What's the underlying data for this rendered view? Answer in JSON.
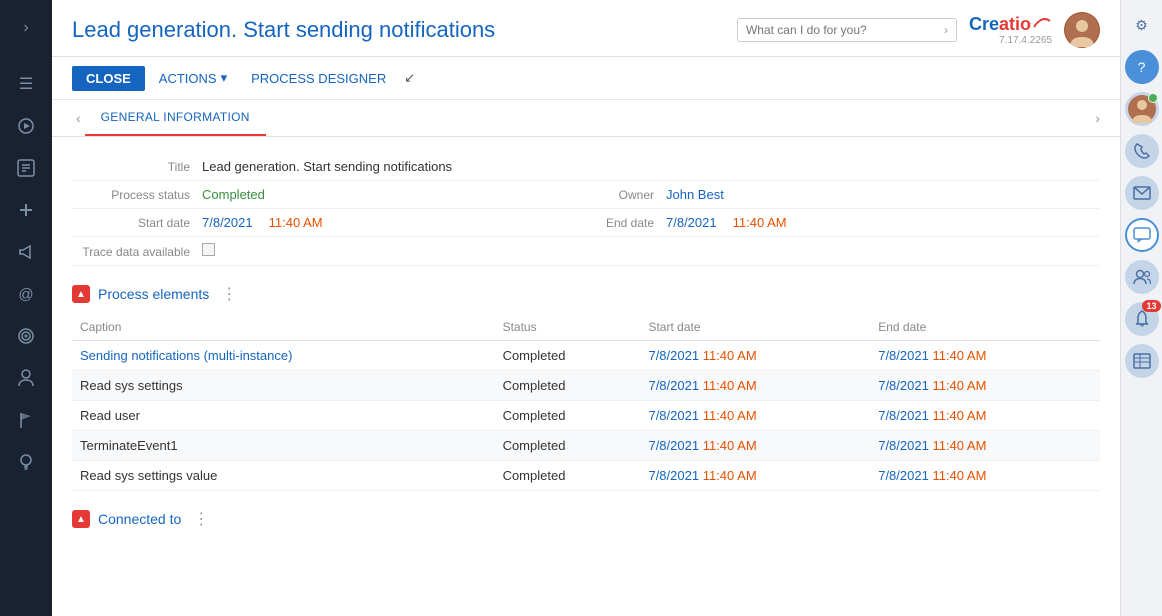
{
  "sidebar": {
    "icons": [
      {
        "name": "chevron-right-icon",
        "symbol": "›",
        "active": false
      },
      {
        "name": "menu-icon",
        "symbol": "☰",
        "active": false
      },
      {
        "name": "play-icon",
        "symbol": "▶",
        "active": false
      },
      {
        "name": "contacts-icon",
        "symbol": "📋",
        "active": false
      },
      {
        "name": "megaphone-icon",
        "symbol": "📣",
        "active": false
      },
      {
        "name": "at-icon",
        "symbol": "@",
        "active": false
      },
      {
        "name": "target-icon",
        "symbol": "🎯",
        "active": false
      },
      {
        "name": "person-icon",
        "symbol": "👤",
        "active": false
      },
      {
        "name": "flag-icon",
        "symbol": "⚑",
        "active": false
      },
      {
        "name": "add-icon",
        "symbol": "+",
        "active": false
      },
      {
        "name": "bulb-icon",
        "symbol": "💡",
        "active": false
      }
    ]
  },
  "header": {
    "title": "Lead generation. Start sending notifications",
    "search_placeholder": "What can I do for you?",
    "logo": "Creatio",
    "version": "7.17.4.2265"
  },
  "toolbar": {
    "close_label": "CLOSE",
    "actions_label": "ACTIONS",
    "process_designer_label": "PROCESS DESIGNER"
  },
  "tabs": {
    "prev_arrow": "‹",
    "next_arrow": "›",
    "items": [
      {
        "label": "GENERAL INFORMATION",
        "active": true
      }
    ]
  },
  "form": {
    "title_label": "Title",
    "title_value": "Lead generation. Start sending notifications",
    "process_status_label": "Process status",
    "process_status_value": "Completed",
    "owner_label": "Owner",
    "owner_value": "John Best",
    "start_date_label": "Start date",
    "start_date_value": "7/8/2021",
    "start_time_value": "11:40 AM",
    "end_date_label": "End date",
    "end_date_value": "7/8/2021",
    "end_time_value": "11:40 AM",
    "trace_label": "Trace data available"
  },
  "process_elements": {
    "section_title": "Process elements",
    "columns": [
      "Caption",
      "Status",
      "Start date",
      "End date"
    ],
    "rows": [
      {
        "caption": "Sending notifications (multi-instance)",
        "is_link": true,
        "status": "Completed",
        "start_date": "7/8/2021",
        "start_time": "11:40 AM",
        "end_date": "7/8/2021",
        "end_time": "11:40 AM"
      },
      {
        "caption": "Read sys settings",
        "is_link": false,
        "status": "Completed",
        "start_date": "7/8/2021",
        "start_time": "11:40 AM",
        "end_date": "7/8/2021",
        "end_time": "11:40 AM"
      },
      {
        "caption": "Read user",
        "is_link": false,
        "status": "Completed",
        "start_date": "7/8/2021",
        "start_time": "11:40 AM",
        "end_date": "7/8/2021",
        "end_time": "11:40 AM"
      },
      {
        "caption": "TerminateEvent1",
        "is_link": false,
        "status": "Completed",
        "start_date": "7/8/2021",
        "start_time": "11:40 AM",
        "end_date": "7/8/2021",
        "end_time": "11:40 AM"
      },
      {
        "caption": "Read sys settings value",
        "is_link": false,
        "status": "Completed",
        "start_date": "7/8/2021",
        "start_time": "11:40 AM",
        "end_date": "7/8/2021",
        "end_time": "11:40 AM"
      }
    ]
  },
  "connected_to": {
    "section_title": "Connected to"
  },
  "right_panel": {
    "icons": [
      {
        "name": "avatar-icon",
        "symbol": "👤",
        "badge": null,
        "active": false
      },
      {
        "name": "phone-icon",
        "symbol": "📞",
        "badge": null,
        "active": false
      },
      {
        "name": "mail-icon",
        "symbol": "✉",
        "badge": null,
        "active": false
      },
      {
        "name": "chat-icon",
        "symbol": "💬",
        "badge": null,
        "active": true
      },
      {
        "name": "users-icon",
        "symbol": "👥",
        "badge": null,
        "active": false
      },
      {
        "name": "bell-icon",
        "symbol": "🔔",
        "badge": "13",
        "active": false
      },
      {
        "name": "table-icon",
        "symbol": "▦",
        "badge": null,
        "active": false
      }
    ],
    "gear": "⚙",
    "question": "?"
  }
}
